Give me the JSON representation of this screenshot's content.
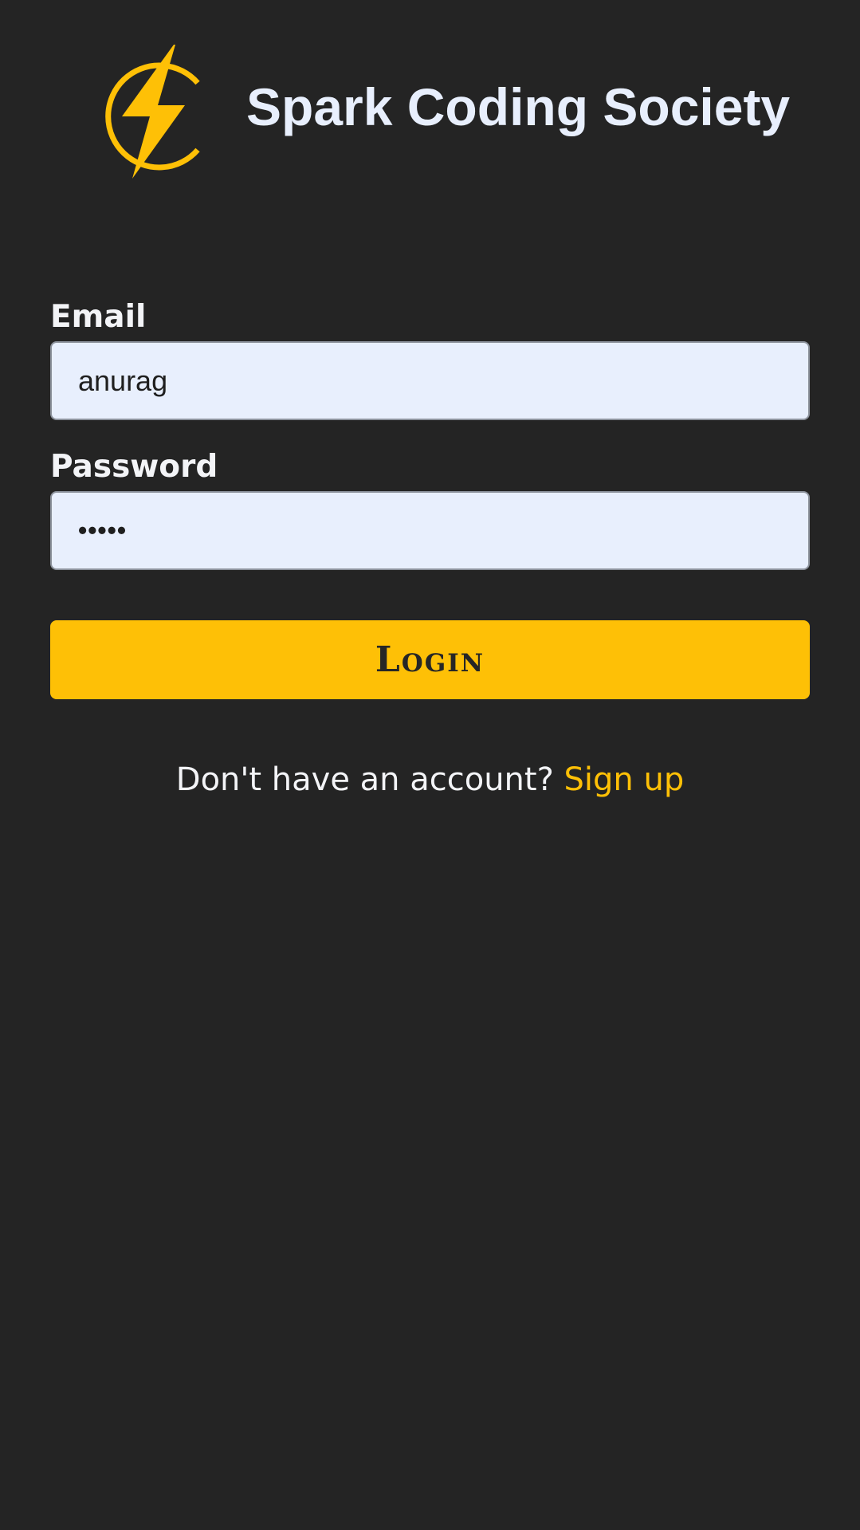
{
  "app": {
    "title": "Spark Coding Society"
  },
  "colors": {
    "background": "#242424",
    "accent": "#fec006",
    "input_background": "#e8effd",
    "text_light": "#f3f4f7",
    "title_text": "#e8effd"
  },
  "logo": {
    "icon": "lightning-bolt-in-c-logo"
  },
  "form": {
    "email": {
      "label": "Email",
      "value": "anurag"
    },
    "password": {
      "label": "Password",
      "value": "•••••"
    },
    "login_button": {
      "label": "Login"
    }
  },
  "signup": {
    "prompt": "Don't have an account?",
    "link_label": "Sign up"
  }
}
